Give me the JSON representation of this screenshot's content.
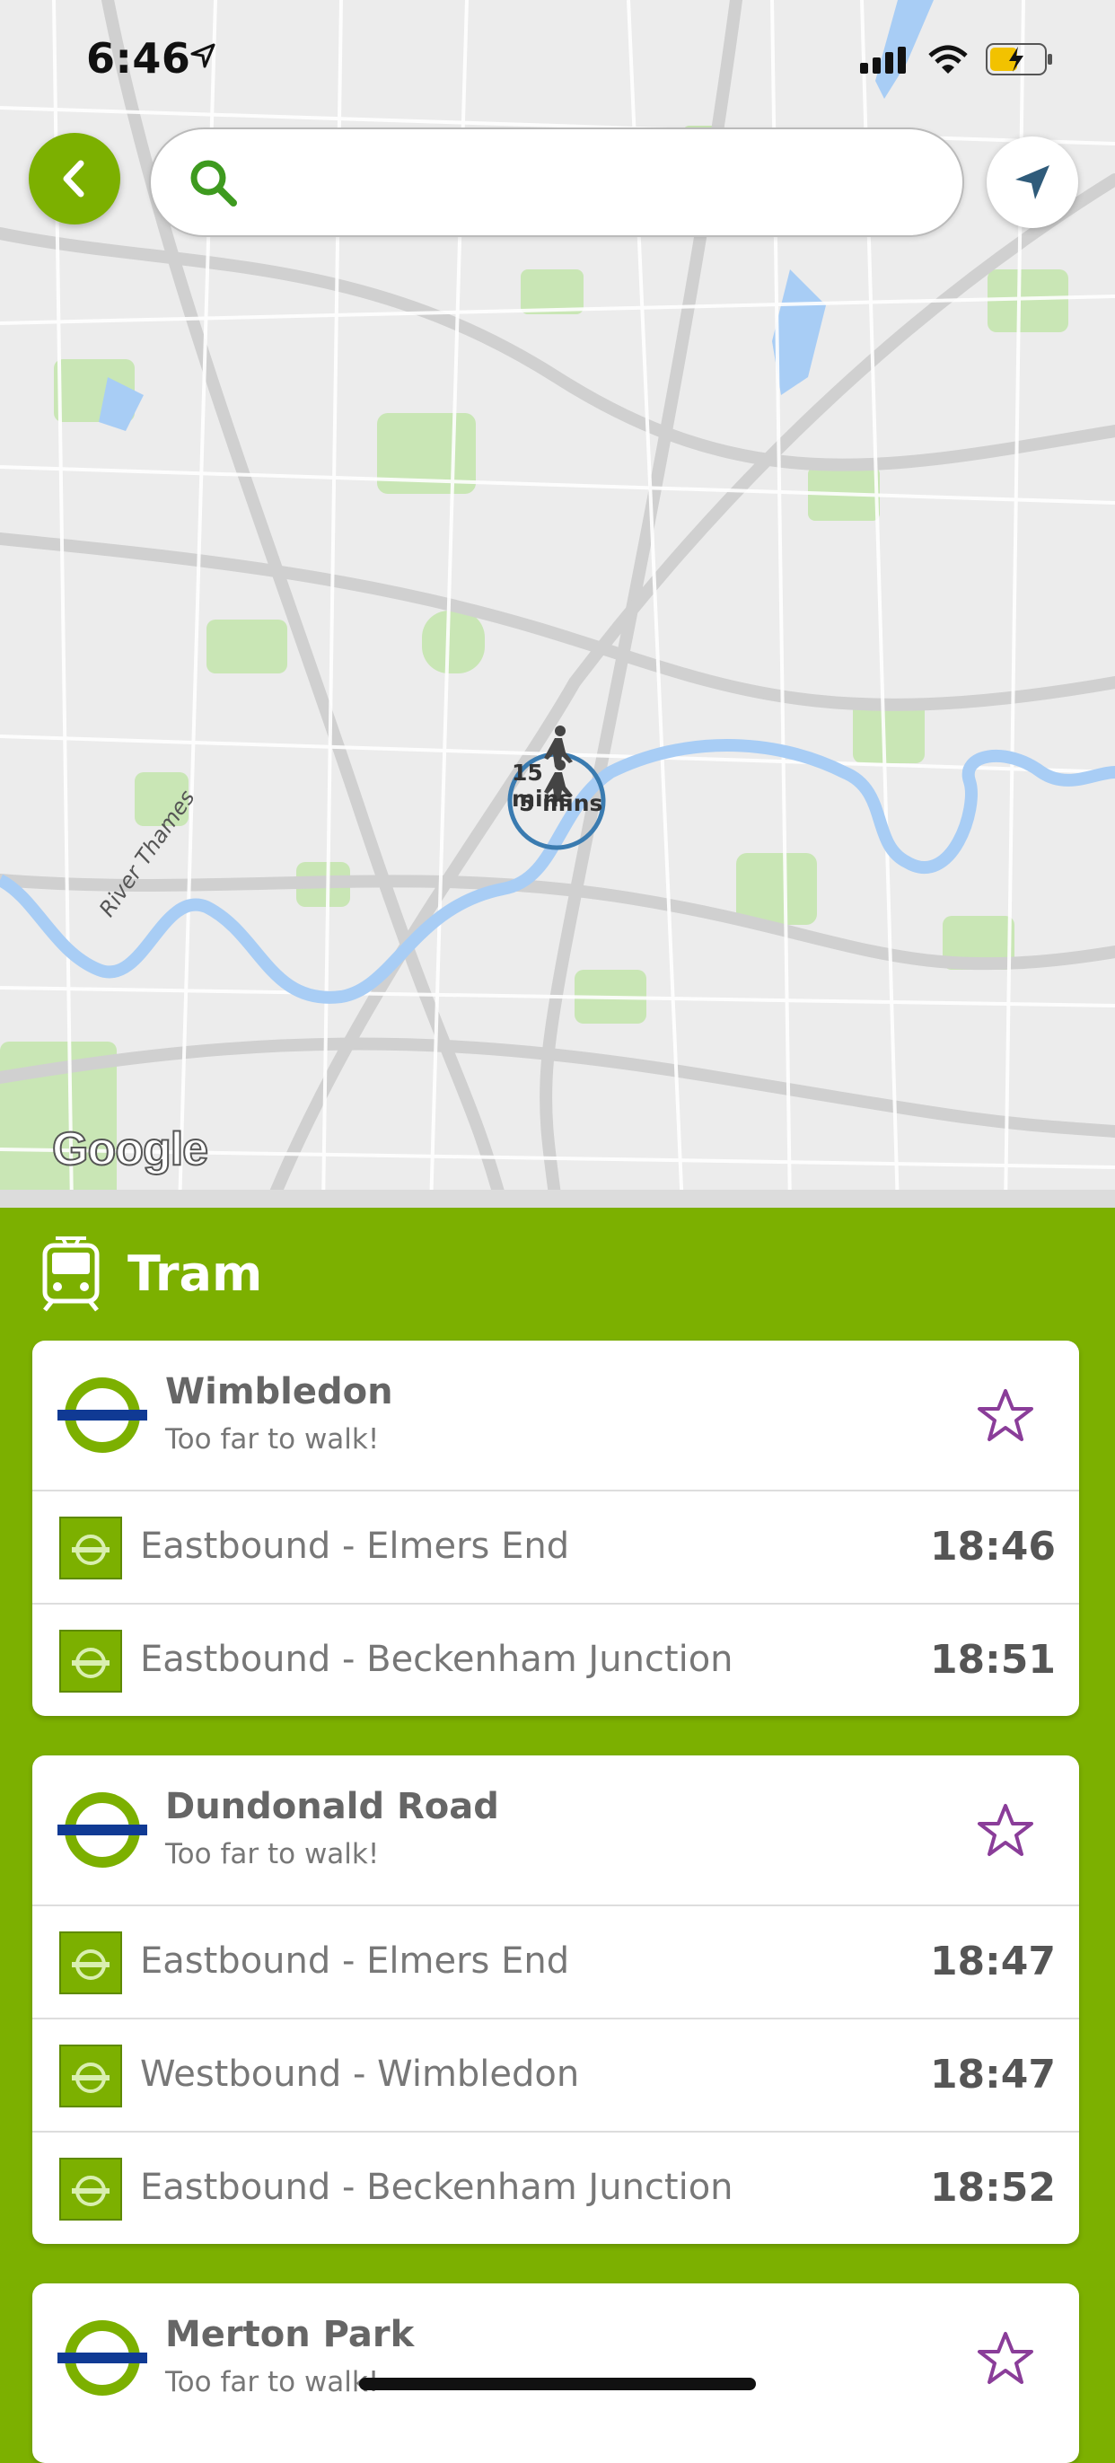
{
  "status_bar": {
    "time": "6:46"
  },
  "search": {
    "placeholder": ""
  },
  "map": {
    "walk_labels": [
      "15 mins",
      "5 mins"
    ],
    "river_label": "River Thames",
    "attribution": "Google"
  },
  "panel": {
    "title": "Tram",
    "accent_color": "#7cb000",
    "stops": [
      {
        "name": "Wimbledon",
        "subtitle": "Too far to walk!",
        "departures": [
          {
            "direction": "Eastbound - Elmers End",
            "time": "18:46"
          },
          {
            "direction": "Eastbound - Beckenham Junction",
            "time": "18:51"
          }
        ]
      },
      {
        "name": "Dundonald Road",
        "subtitle": "Too far to walk!",
        "departures": [
          {
            "direction": "Eastbound - Elmers End",
            "time": "18:47"
          },
          {
            "direction": "Westbound - Wimbledon",
            "time": "18:47"
          },
          {
            "direction": "Eastbound - Beckenham Junction",
            "time": "18:52"
          }
        ]
      },
      {
        "name": "Merton Park",
        "subtitle": "Too far to walk!",
        "departures": []
      }
    ]
  },
  "icons": {
    "back": "chevron-left-icon",
    "search": "search-icon",
    "locate": "navigation-arrow-icon",
    "tram": "tram-icon",
    "favorite": "star-outline-icon",
    "roundel": "tram-roundel-icon"
  }
}
